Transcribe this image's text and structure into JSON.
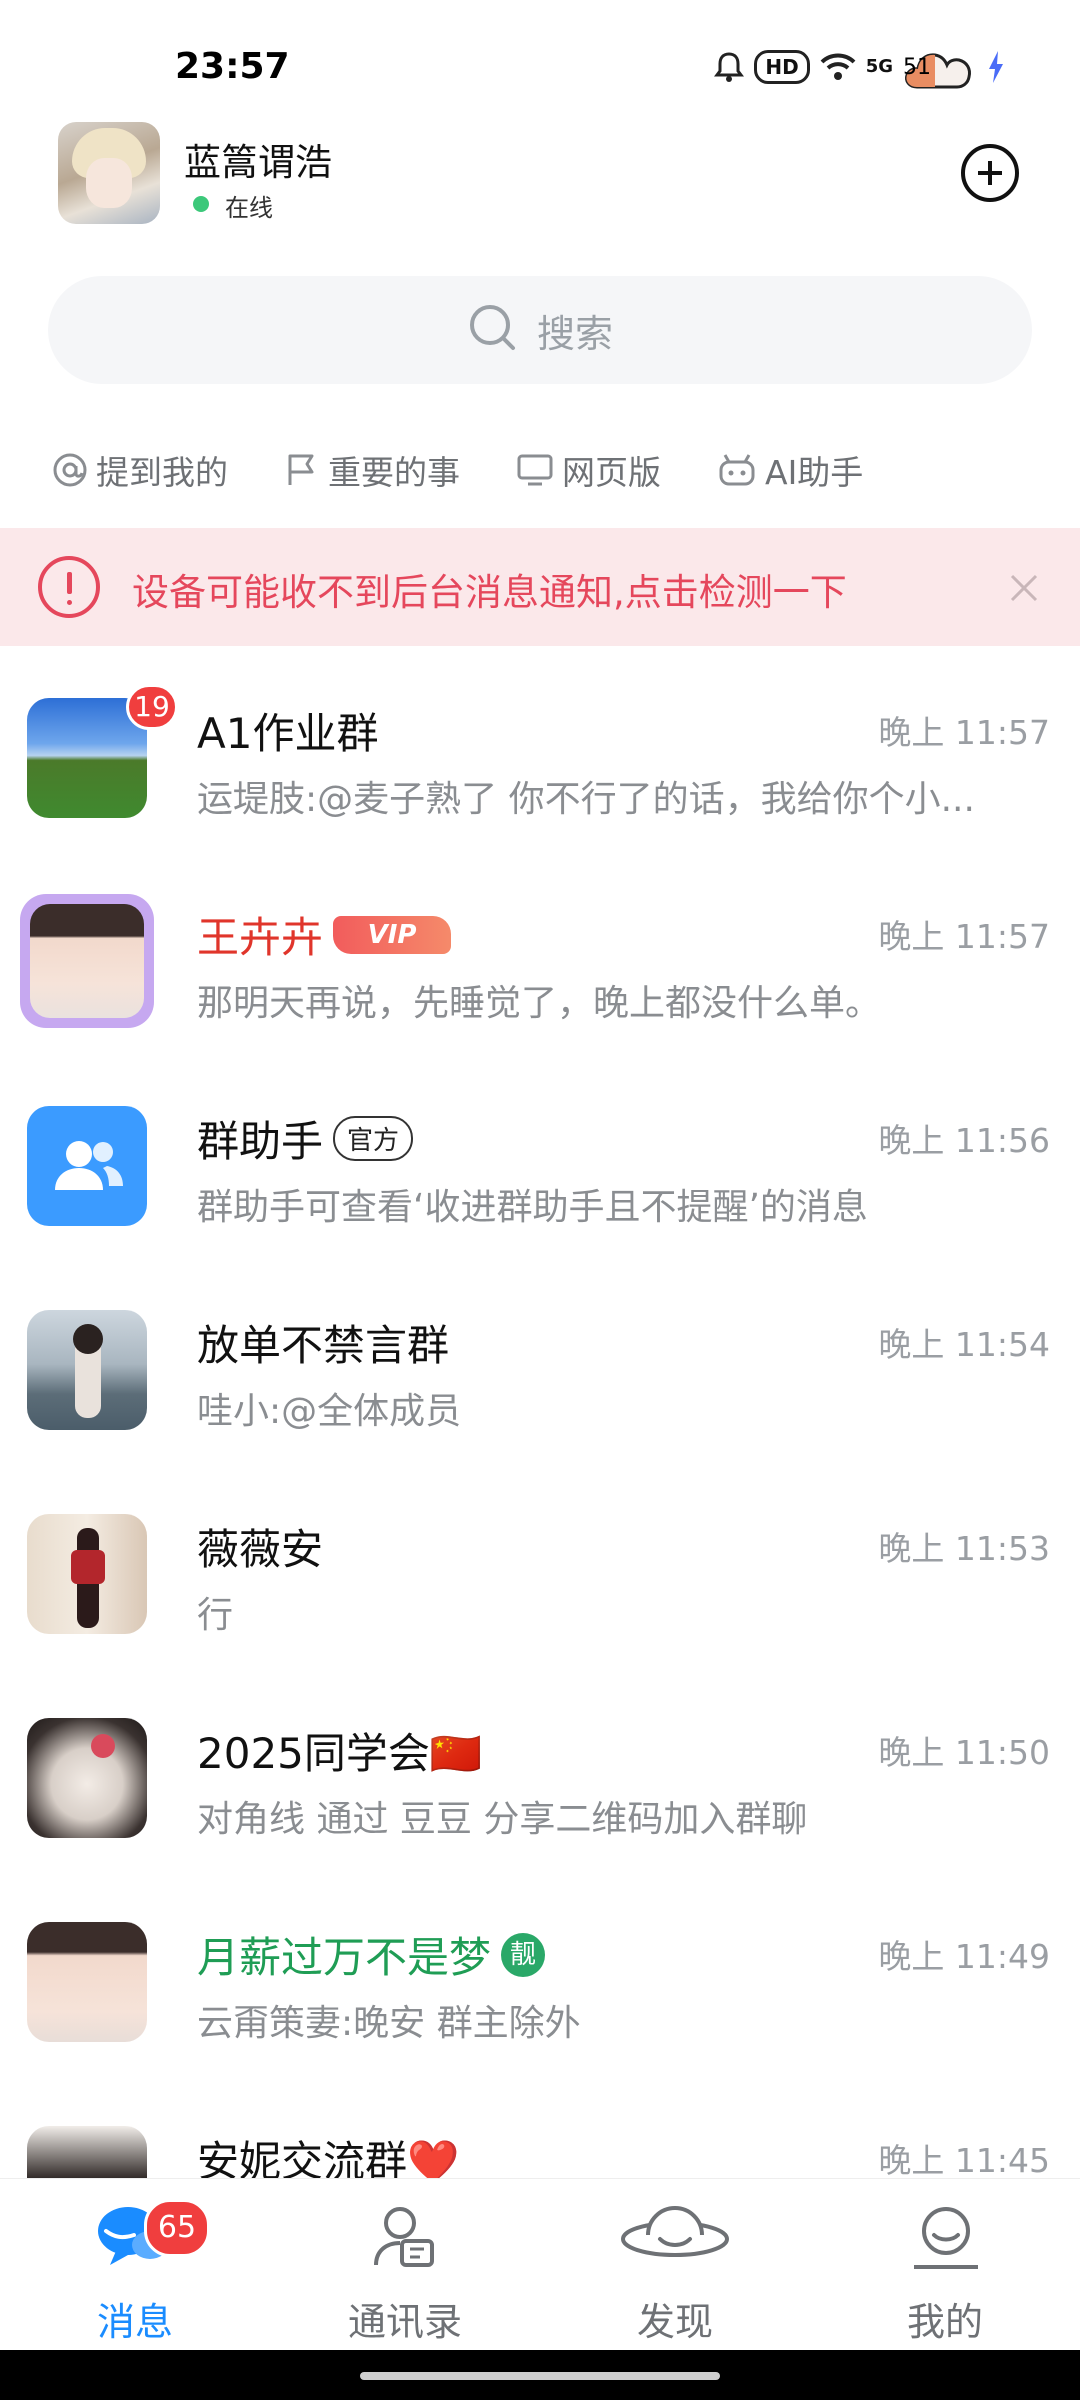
{
  "status_bar": {
    "time": "23:57",
    "hd_label": "HD",
    "network_label": "5G",
    "battery_level": "51",
    "icons": [
      "bell-icon",
      "hd-icon",
      "wifi-icon",
      "5g-signal-icon",
      "battery-icon",
      "charging-icon"
    ]
  },
  "header": {
    "user_name": "蓝篙谓浩",
    "status": "在线"
  },
  "search": {
    "placeholder": "搜索"
  },
  "quick_tabs": [
    {
      "label": "提到我的",
      "icon": "at-icon"
    },
    {
      "label": "重要的事",
      "icon": "flag-icon"
    },
    {
      "label": "网页版",
      "icon": "monitor-icon"
    },
    {
      "label": "AI助手",
      "icon": "robot-icon"
    }
  ],
  "warning": {
    "text": "设备可能收不到后台消息通知,点击检测一下"
  },
  "chats": [
    {
      "name": "A1作业群",
      "time": "晚上 11:57",
      "preview": "运堤肢:@麦子熟了 你不行了的话，我给你个小...",
      "badge": "19"
    },
    {
      "name": "王卉卉",
      "time": "晚上 11:57",
      "preview": "那明天再说，先睡觉了，晚上都没什么单。",
      "tag": "VIP"
    },
    {
      "name": "群助手",
      "time": "晚上 11:56",
      "preview": "群助手可查看‘收进群助手且不提醒’的消息",
      "tag": "官方"
    },
    {
      "name": "放单不禁言群",
      "time": "晚上 11:54",
      "preview": "哇小:@全体成员"
    },
    {
      "name": "薇薇安",
      "time": "晚上 11:53",
      "preview": "行"
    },
    {
      "name": "2025同学会🇨🇳",
      "time": "晚上 11:50",
      "preview": " 对角线 通过 豆豆 分享二维码加入群聊"
    },
    {
      "name": "月薪过万不是梦",
      "time": "晚上 11:49",
      "preview": "云甭策妻:晚安  群主除外",
      "tag": "靓"
    },
    {
      "name": "安妮交流群❤️",
      "time": "晚上 11:45",
      "preview": ""
    }
  ],
  "bottom_nav": [
    {
      "label": "消息",
      "badge": "65",
      "active": true
    },
    {
      "label": "通讯录"
    },
    {
      "label": "发现"
    },
    {
      "label": "我的"
    }
  ],
  "colors": {
    "accent": "#1a8cff",
    "warning": "#e5475c",
    "badge": "#f03e3e",
    "vip_name": "#e0352b",
    "green_name": "#1f9d55"
  }
}
